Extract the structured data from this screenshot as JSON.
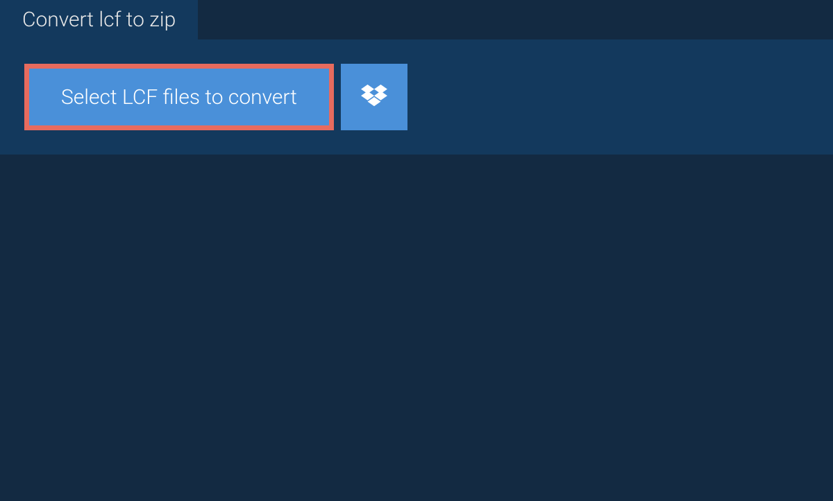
{
  "tab": {
    "title": "Convert lcf to zip"
  },
  "buttons": {
    "select_label": "Select LCF files to convert"
  },
  "colors": {
    "background_dark": "#0d2d4d",
    "panel": "#13395d",
    "darker": "#132a42",
    "button_blue": "#4a90d9",
    "highlight_border": "#e76b5e",
    "text_light": "#e8e8e8"
  }
}
